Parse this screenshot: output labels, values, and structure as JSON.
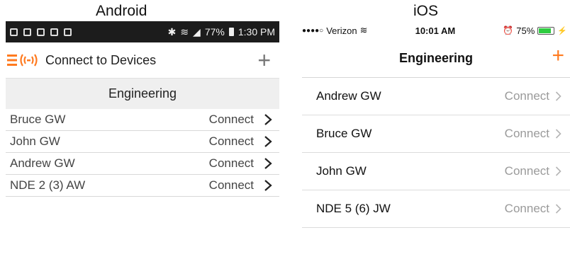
{
  "android": {
    "platform_label": "Android",
    "status": {
      "right_text": "77%",
      "time": "1:30 PM"
    },
    "appbar": {
      "title": "Connect to Devices",
      "add_icon": "plus-icon",
      "logo_icon": "connect-logo-icon"
    },
    "group_header": "Engineering",
    "devices": [
      {
        "name": "Bruce GW",
        "action": "Connect"
      },
      {
        "name": "John GW",
        "action": "Connect"
      },
      {
        "name": "Andrew GW",
        "action": "Connect"
      },
      {
        "name": "NDE 2 (3) AW",
        "action": "Connect"
      }
    ]
  },
  "ios": {
    "platform_label": "iOS",
    "status": {
      "carrier": "Verizon",
      "time": "10:01 AM",
      "battery": "75%"
    },
    "navbar": {
      "title": "Engineering",
      "add_icon": "plus-icon"
    },
    "devices": [
      {
        "name": "Andrew GW",
        "action": "Connect"
      },
      {
        "name": "Bruce GW",
        "action": "Connect"
      },
      {
        "name": "John GW",
        "action": "Connect"
      },
      {
        "name": "NDE  5 (6) JW",
        "action": "Connect"
      }
    ]
  },
  "colors": {
    "accent": "#ff7a1f",
    "android_status_bg": "#1c1c1c",
    "ios_connect": "#9a9a9a"
  }
}
